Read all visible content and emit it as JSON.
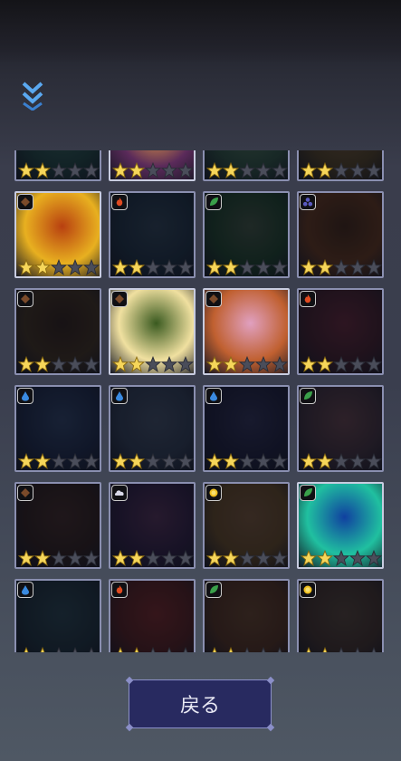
{
  "back_button": {
    "label": "戻る"
  },
  "collapse_icon": "double-chevron-down-icon",
  "star_max": 5,
  "colors": {
    "star_filled": "#f6d65a",
    "star_empty": "#4a4d5a",
    "card_border": "#8a8fb0",
    "button_bg": "#282a60"
  },
  "cards": [
    {
      "element": "none",
      "stars": 2,
      "lit": false,
      "palette": [
        "#1d3d3a",
        "#315a52"
      ]
    },
    {
      "element": "none",
      "stars": 2,
      "lit": true,
      "palette": [
        "#5a2a5a",
        "#e8a040"
      ]
    },
    {
      "element": "none",
      "stars": 2,
      "lit": false,
      "palette": [
        "#2a4a3a",
        "#4a6a50"
      ]
    },
    {
      "element": "none",
      "stars": 2,
      "lit": false,
      "palette": [
        "#4a3a20",
        "#6a5030"
      ]
    },
    {
      "element": "earth",
      "stars": 2,
      "lit": true,
      "palette": [
        "#e8b020",
        "#b84010"
      ]
    },
    {
      "element": "fire",
      "stars": 2,
      "lit": false,
      "palette": [
        "#1a2a3a",
        "#2a3a4a"
      ]
    },
    {
      "element": "leaf",
      "stars": 2,
      "lit": false,
      "palette": [
        "#1a3a24",
        "#3a4a3a"
      ]
    },
    {
      "element": "dark",
      "stars": 2,
      "lit": false,
      "palette": [
        "#5a3018",
        "#3a2010"
      ]
    },
    {
      "element": "earth",
      "stars": 2,
      "lit": false,
      "palette": [
        "#3a2a1a",
        "#2a1a14"
      ]
    },
    {
      "element": "earth",
      "stars": 2,
      "lit": true,
      "palette": [
        "#f0e0a0",
        "#3a5a20"
      ]
    },
    {
      "element": "earth",
      "stars": 2,
      "lit": true,
      "palette": [
        "#c06030",
        "#e0a0c0"
      ]
    },
    {
      "element": "fire",
      "stars": 2,
      "lit": false,
      "palette": [
        "#3a1a24",
        "#5a2030"
      ]
    },
    {
      "element": "water",
      "stars": 2,
      "lit": false,
      "palette": [
        "#1a2440",
        "#2a3a5a"
      ]
    },
    {
      "element": "water",
      "stars": 2,
      "lit": false,
      "palette": [
        "#2a3448",
        "#3a4458"
      ]
    },
    {
      "element": "water",
      "stars": 2,
      "lit": false,
      "palette": [
        "#1a1a34",
        "#2a2a4a"
      ]
    },
    {
      "element": "leaf",
      "stars": 2,
      "lit": false,
      "palette": [
        "#3a2a34",
        "#5a3a40"
      ]
    },
    {
      "element": "earth",
      "stars": 2,
      "lit": false,
      "palette": [
        "#2a1a18",
        "#3a2420"
      ]
    },
    {
      "element": "cloud",
      "stars": 2,
      "lit": false,
      "palette": [
        "#2a1a3a",
        "#4a2a4a"
      ]
    },
    {
      "element": "light",
      "stars": 2,
      "lit": false,
      "palette": [
        "#5a4020",
        "#6a4a30"
      ]
    },
    {
      "element": "leaf",
      "stars": 2,
      "lit": true,
      "palette": [
        "#20c0a0",
        "#1040a0"
      ]
    },
    {
      "element": "water",
      "stars": 2,
      "lit": false,
      "palette": [
        "#1a2a34",
        "#243a44"
      ]
    },
    {
      "element": "fire",
      "stars": 2,
      "lit": false,
      "palette": [
        "#4a1a1a",
        "#6a2020"
      ]
    },
    {
      "element": "leaf",
      "stars": 2,
      "lit": false,
      "palette": [
        "#4a2a1a",
        "#5a3a24"
      ]
    },
    {
      "element": "light",
      "stars": 2,
      "lit": false,
      "palette": [
        "#3a2a24",
        "#4a3a30"
      ]
    }
  ]
}
